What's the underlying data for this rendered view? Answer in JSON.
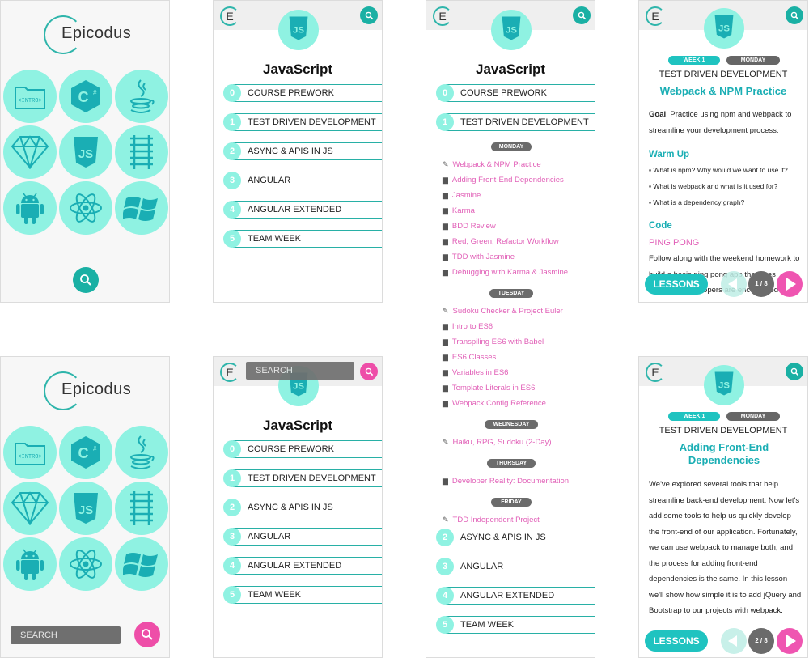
{
  "brand": {
    "name": "Epicodus",
    "short": "E",
    "accent": "#1ab0a4",
    "tile": "#8ff2e2",
    "pink": "#ee4ea8"
  },
  "home": {
    "tiles": [
      {
        "icon": "intro-folder-icon",
        "label": "<INTRO>"
      },
      {
        "icon": "csharp-icon",
        "label": "C#"
      },
      {
        "icon": "java-icon",
        "label": ""
      },
      {
        "icon": "sketch-diamond-icon",
        "label": ""
      },
      {
        "icon": "javascript-icon",
        "label": "JS"
      },
      {
        "icon": "rails-track-icon",
        "label": ""
      },
      {
        "icon": "android-icon",
        "label": ""
      },
      {
        "icon": "react-atom-icon",
        "label": ""
      },
      {
        "icon": "windows-icon",
        "label": ""
      }
    ],
    "search_placeholder": "SEARCH"
  },
  "course": {
    "title": "JavaScript",
    "badge": "JS",
    "sections": [
      {
        "num": "0",
        "label": "COURSE PREWORK"
      },
      {
        "num": "1",
        "label": "TEST DRIVEN DEVELOPMENT"
      },
      {
        "num": "2",
        "label": "ASYNC & APIS IN JS"
      },
      {
        "num": "3",
        "label": "ANGULAR"
      },
      {
        "num": "4",
        "label": "ANGULAR EXTENDED"
      },
      {
        "num": "5",
        "label": "TEAM WEEK"
      }
    ],
    "search_placeholder": "SEARCH"
  },
  "expanded": {
    "days": [
      {
        "day": "MONDAY",
        "lessons": [
          {
            "type": "pencil",
            "title": "Webpack & NPM Practice"
          },
          {
            "type": "book",
            "title": "Adding Front-End Dependencies"
          },
          {
            "type": "book",
            "title": "Jasmine"
          },
          {
            "type": "book",
            "title": "Karma"
          },
          {
            "type": "book",
            "title": "BDD Review"
          },
          {
            "type": "book",
            "title": "Red, Green, Refactor Workflow"
          },
          {
            "type": "book",
            "title": "TDD with Jasmine"
          },
          {
            "type": "book",
            "title": "Debugging with Karma & Jasmine"
          }
        ]
      },
      {
        "day": "TUESDAY",
        "lessons": [
          {
            "type": "pencil",
            "title": "Sudoku Checker & Project Euler"
          },
          {
            "type": "book",
            "title": "Intro to ES6"
          },
          {
            "type": "book",
            "title": "Transpiling ES6 with Babel"
          },
          {
            "type": "book",
            "title": "ES6 Classes"
          },
          {
            "type": "book",
            "title": "Variables in ES6"
          },
          {
            "type": "book",
            "title": "Template Literals in ES6"
          },
          {
            "type": "book",
            "title": "Webpack Config Reference"
          }
        ]
      },
      {
        "day": "WEDNESDAY",
        "lessons": [
          {
            "type": "pencil",
            "title": "Haiku, RPG, Sudoku (2-Day)"
          }
        ]
      },
      {
        "day": "THURSDAY",
        "lessons": [
          {
            "type": "book",
            "title": "Developer Reality: Documentation"
          }
        ]
      },
      {
        "day": "FRIDAY",
        "lessons": [
          {
            "type": "pencil",
            "title": "TDD Independent Project"
          }
        ]
      }
    ]
  },
  "detail1": {
    "week": "WEEK 1",
    "day": "MONDAY",
    "section": "TEST DRIVEN DEVELOPMENT",
    "title": "Webpack & NPM Practice",
    "goal_label": "Goal",
    "goal_text": ": Practice using npm and webpack to streamline your development process.",
    "warmup_heading": "Warm Up",
    "warmup_items": [
      "What is npm? Why would we want to use it?",
      "What is webpack and what is it used for?",
      "What is a dependency graph?"
    ],
    "code_heading": "Code",
    "code_sub": "PING PONG",
    "code_text": "Follow along with the weekend homework to build a basic ping pong app that uses webpack. Developers are encouraged",
    "lessons_label": "LESSONS",
    "counter": "1 / 8"
  },
  "detail2": {
    "week": "WEEK 1",
    "day": "MONDAY",
    "section": "TEST DRIVEN DEVELOPMENT",
    "title": "Adding Front-End Dependencies",
    "body": "We've explored several tools that help streamline back-end development. Now let's add some tools to help us quickly develop the front-end of our application. Fortunately, we can use webpack to manage both, and the process for adding front-end dependencies is the same. In this lesson we'll show how simple it is to add jQuery and Bootstrap to our projects with webpack.",
    "lessons_label": "LESSONS",
    "counter": "2 / 8"
  }
}
